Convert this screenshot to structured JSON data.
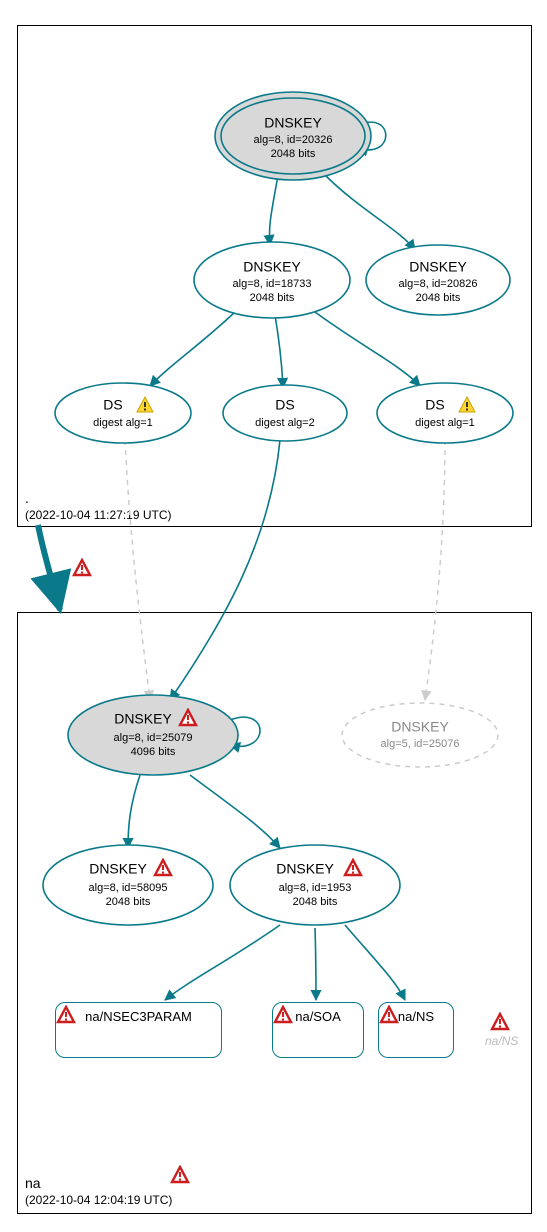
{
  "zones": {
    "root": {
      "label": ".",
      "time": "(2022-10-04 11:27:19 UTC)"
    },
    "na": {
      "label": "na",
      "time": "(2022-10-04 12:04:19 UTC)"
    }
  },
  "nodes": {
    "ksk_root": {
      "title": "DNSKEY",
      "l2": "alg=8, id=20326",
      "l3": "2048 bits"
    },
    "zsk_root1": {
      "title": "DNSKEY",
      "l2": "alg=8, id=18733",
      "l3": "2048 bits"
    },
    "zsk_root2": {
      "title": "DNSKEY",
      "l2": "alg=8, id=20826",
      "l3": "2048 bits"
    },
    "ds1": {
      "title": "DS",
      "l2": "digest alg=1"
    },
    "ds2": {
      "title": "DS",
      "l2": "digest alg=2"
    },
    "ds3": {
      "title": "DS",
      "l2": "digest alg=1"
    },
    "ksk_na": {
      "title": "DNSKEY",
      "l2": "alg=8, id=25079",
      "l3": "4096 bits"
    },
    "ghost_na": {
      "title": "DNSKEY",
      "l2": "alg=5, id=25076"
    },
    "zsk_na1": {
      "title": "DNSKEY",
      "l2": "alg=8, id=58095",
      "l3": "2048 bits"
    },
    "zsk_na2": {
      "title": "DNSKEY",
      "l2": "alg=8, id=1953",
      "l3": "2048 bits"
    }
  },
  "rr": {
    "nsec3": "na/NSEC3PARAM",
    "soa": "na/SOA",
    "ns": "na/NS",
    "ghostns": "na/NS"
  }
}
